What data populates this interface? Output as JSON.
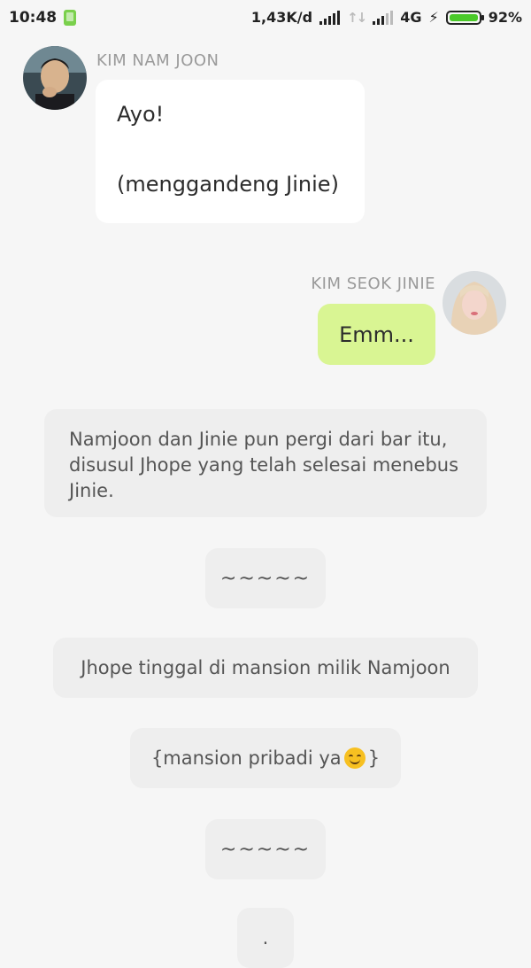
{
  "status_bar": {
    "time": "10:48",
    "network_speed": "1,43K/d",
    "network_type": "4G",
    "battery_percent": "92%",
    "battery_level": 0.92,
    "sim_icon": "sim-card-icon",
    "charging_icon": "lightning-bolt-icon"
  },
  "messages": [
    {
      "sender": "KIM NAM JOON",
      "line1": "Ayo!",
      "line2": "(menggandeng Jinie)",
      "side": "left"
    },
    {
      "sender": "KIM SEOK JINIE",
      "text": "Emm...",
      "side": "right"
    }
  ],
  "narrations": [
    {
      "text": "Namjoon dan Jinie pun pergi dari bar itu, disusul Jhope yang telah selesai menebus Jinie."
    },
    {
      "text": "~~~~~"
    },
    {
      "text": "Jhope tinggal di mansion milik Namjoon"
    },
    {
      "text_before": "{mansion pribadi ya",
      "emoji": "smiling-face-icon",
      "text_after": "}"
    },
    {
      "text": "~~~~~"
    },
    {
      "text": "."
    }
  ],
  "colors": {
    "background": "#f6f6f6",
    "incoming_bubble": "#ffffff",
    "outgoing_bubble": "#d9f593",
    "narration_bubble": "#eeeeee",
    "battery_fill": "#4bc92a"
  }
}
